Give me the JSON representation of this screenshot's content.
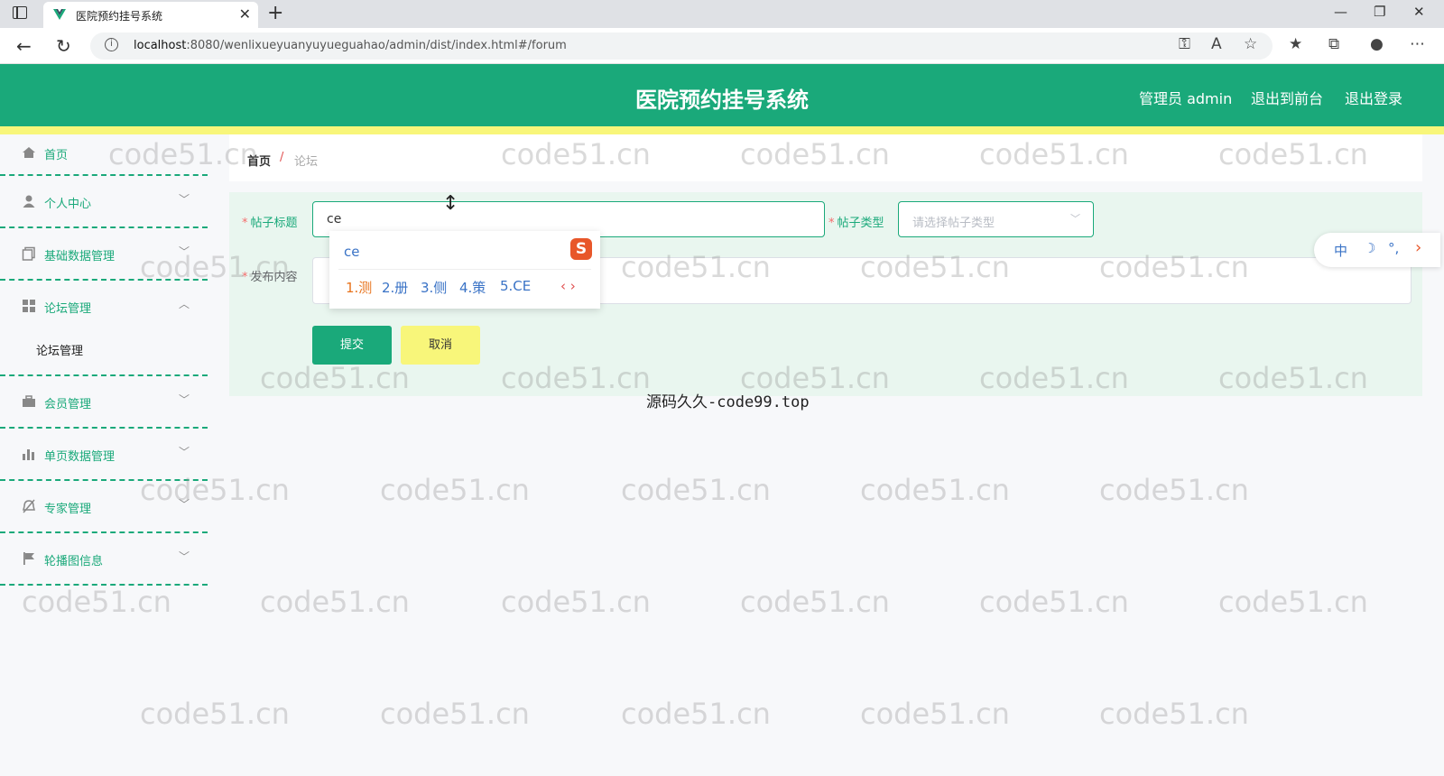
{
  "browser": {
    "tab_title": "医院预约挂号系统",
    "url_host": "localhost",
    "url_rest": ":8080/wenlixueyuanyuyueguahao/admin/dist/index.html#/forum"
  },
  "header": {
    "title": "医院预约挂号系统",
    "admin_label": "管理员 admin",
    "exit_front": "退出到前台",
    "logout": "退出登录"
  },
  "sidebar": {
    "items": [
      {
        "label": "首页",
        "icon": "home-icon"
      },
      {
        "label": "个人中心",
        "icon": "user-icon"
      },
      {
        "label": "基础数据管理",
        "icon": "copy-icon"
      },
      {
        "label": "论坛管理",
        "icon": "grid-icon",
        "sub": "论坛管理"
      },
      {
        "label": "会员管理",
        "icon": "briefcase-icon"
      },
      {
        "label": "单页数据管理",
        "icon": "bar-chart-icon"
      },
      {
        "label": "专家管理",
        "icon": "bell-off-icon"
      },
      {
        "label": "轮播图信息",
        "icon": "flag-icon"
      }
    ]
  },
  "breadcrumb": {
    "home": "首页",
    "separator": "/",
    "current": "论坛"
  },
  "form": {
    "title_label": "帖子标题",
    "title_value": "ce",
    "type_label": "帖子类型",
    "type_placeholder": "请选择帖子类型",
    "content_label": "发布内容",
    "submit": "提交",
    "cancel": "取消"
  },
  "ime": {
    "composition": "ce",
    "logo": "S",
    "candidates": [
      "1.测",
      "2.册",
      "3.侧",
      "4.策",
      "5.CE"
    ],
    "bar": {
      "lang": "中",
      "mode": "☽",
      "punct": "°,"
    }
  },
  "caption": "源码久久-code99.top",
  "watermark": "code51.cn",
  "colors": {
    "primary": "#1aa97a",
    "accent_yellow": "#f8f67a",
    "required": "#f56c6c"
  }
}
